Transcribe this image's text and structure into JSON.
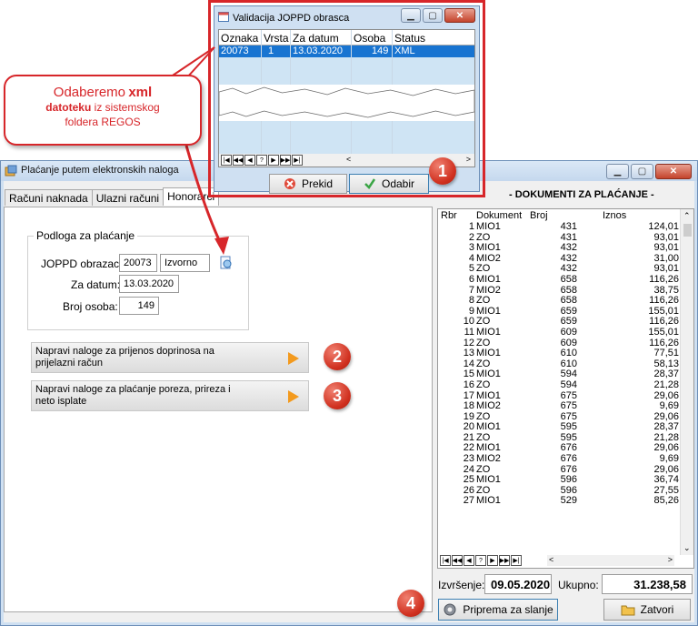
{
  "main_window": {
    "title": "Plaćanje putem elektronskih naloga",
    "tabs": [
      "Računi naknada",
      "Ulazni računi",
      "Honorarci"
    ],
    "groupbox": {
      "label": "Podloga za plaćanje",
      "joppd_label": "JOPPD obrazac:",
      "joppd_value": "20073",
      "joppd_type": "Izvorno",
      "date_label": "Za datum:",
      "date_value": "13.03.2020",
      "persons_label": "Broj osoba:",
      "persons_value": "149"
    },
    "action_btn_1": "Napravi naloge za prijenos doprinosa na prijelazni račun",
    "action_btn_2": "Napravi naloge za plaćanje poreza, prireza i neto isplate",
    "docs_title": "- DOKUMENTI ZA PLAĆANJE -",
    "grid_headers": {
      "rbr": "Rbr",
      "dokument": "Dokument",
      "broj": "Broj",
      "iznos": "Iznos"
    },
    "grid_rows": [
      {
        "rbr": "1",
        "dokument": "MIO1",
        "broj": "431",
        "iznos": "124,01"
      },
      {
        "rbr": "2",
        "dokument": "ZO",
        "broj": "431",
        "iznos": "93,01"
      },
      {
        "rbr": "3",
        "dokument": "MIO1",
        "broj": "432",
        "iznos": "93,01"
      },
      {
        "rbr": "4",
        "dokument": "MIO2",
        "broj": "432",
        "iznos": "31,00"
      },
      {
        "rbr": "5",
        "dokument": "ZO",
        "broj": "432",
        "iznos": "93,01"
      },
      {
        "rbr": "6",
        "dokument": "MIO1",
        "broj": "658",
        "iznos": "116,26"
      },
      {
        "rbr": "7",
        "dokument": "MIO2",
        "broj": "658",
        "iznos": "38,75"
      },
      {
        "rbr": "8",
        "dokument": "ZO",
        "broj": "658",
        "iznos": "116,26"
      },
      {
        "rbr": "9",
        "dokument": "MIO1",
        "broj": "659",
        "iznos": "155,01"
      },
      {
        "rbr": "10",
        "dokument": "ZO",
        "broj": "659",
        "iznos": "116,26"
      },
      {
        "rbr": "11",
        "dokument": "MIO1",
        "broj": "609",
        "iznos": "155,01"
      },
      {
        "rbr": "12",
        "dokument": "ZO",
        "broj": "609",
        "iznos": "116,26"
      },
      {
        "rbr": "13",
        "dokument": "MIO1",
        "broj": "610",
        "iznos": "77,51"
      },
      {
        "rbr": "14",
        "dokument": "ZO",
        "broj": "610",
        "iznos": "58,13"
      },
      {
        "rbr": "15",
        "dokument": "MIO1",
        "broj": "594",
        "iznos": "28,37"
      },
      {
        "rbr": "16",
        "dokument": "ZO",
        "broj": "594",
        "iznos": "21,28"
      },
      {
        "rbr": "17",
        "dokument": "MIO1",
        "broj": "675",
        "iznos": "29,06"
      },
      {
        "rbr": "18",
        "dokument": "MIO2",
        "broj": "675",
        "iznos": "9,69"
      },
      {
        "rbr": "19",
        "dokument": "ZO",
        "broj": "675",
        "iznos": "29,06"
      },
      {
        "rbr": "20",
        "dokument": "MIO1",
        "broj": "595",
        "iznos": "28,37"
      },
      {
        "rbr": "21",
        "dokument": "ZO",
        "broj": "595",
        "iznos": "21,28"
      },
      {
        "rbr": "22",
        "dokument": "MIO1",
        "broj": "676",
        "iznos": "29,06"
      },
      {
        "rbr": "23",
        "dokument": "MIO2",
        "broj": "676",
        "iznos": "9,69"
      },
      {
        "rbr": "24",
        "dokument": "ZO",
        "broj": "676",
        "iznos": "29,06"
      },
      {
        "rbr": "25",
        "dokument": "MIO1",
        "broj": "596",
        "iznos": "36,74"
      },
      {
        "rbr": "26",
        "dokument": "ZO",
        "broj": "596",
        "iznos": "27,55"
      },
      {
        "rbr": "27",
        "dokument": "MIO1",
        "broj": "529",
        "iznos": "85,26"
      }
    ],
    "izvrsenje_label": "Izvršenje:",
    "izvrsenje_value": "09.05.2020",
    "ukupno_label": "Ukupno:",
    "ukupno_value": "31.238,58",
    "btn_prepare": "Priprema za slanje",
    "btn_close": "Zatvori"
  },
  "popup": {
    "title": "Validacija JOPPD obrasca",
    "headers": [
      "Oznaka",
      "Vrsta",
      "Za datum",
      "Osoba",
      "Status"
    ],
    "row": {
      "oznaka": "20073",
      "vrsta": "1",
      "za_datum": "13.03.2020",
      "osoba": "149",
      "status": "XML"
    },
    "btn_cancel": "Prekid",
    "btn_select": "Odabir"
  },
  "callout": {
    "line1": "Odaberemo",
    "line1_bold": "xml",
    "line2_bold": "datoteku",
    "line2": "iz sistemskog",
    "line3": "foldera REGOS"
  },
  "badges": [
    "1",
    "2",
    "3",
    "4"
  ],
  "colors": {
    "accent_red": "#d7262a",
    "selection_blue": "#1874d1",
    "arrow_orange": "#f39a1e"
  }
}
